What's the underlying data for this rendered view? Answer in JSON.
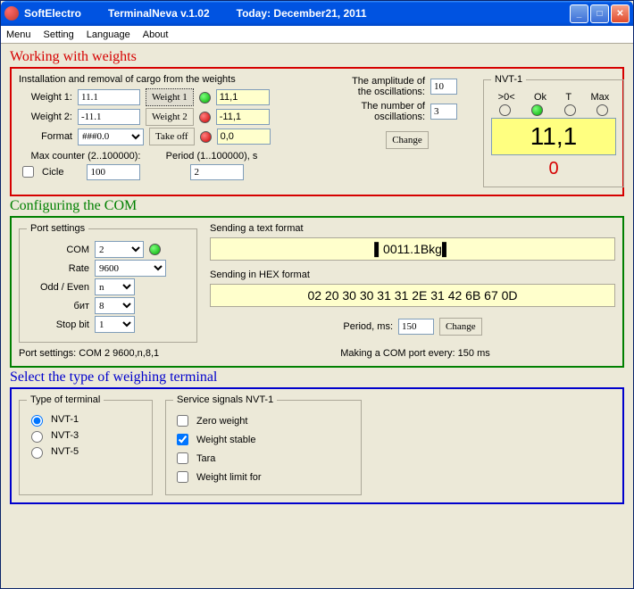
{
  "titlebar": {
    "app": "SoftElectro",
    "name": "TerminalNeva v.1.02",
    "today": "Today: December21,  2011"
  },
  "menu": [
    "Menu",
    "Setting",
    "Language",
    "About"
  ],
  "weights": {
    "title": "Working with weights",
    "install_legend": "Installation and removal of cargo from the weights",
    "w1_lbl": "Weight 1:",
    "w1": "11.1",
    "w1_btn": "Weight 1",
    "w1_out": "11,1",
    "w2_lbl": "Weight 2:",
    "w2": "-11.1",
    "w2_btn": "Weight 2",
    "w2_out": "-11,1",
    "fmt_lbl": "Format",
    "fmt": "###0.0",
    "takeoff_btn": "Take off",
    "fmt_out": "0,0",
    "maxc_lbl": "Max counter (2..100000):",
    "period_lbl": "Period (1..100000), s",
    "cicle_lbl": "Cicle",
    "maxc": "100",
    "period": "2",
    "amp_lbl": "The amplitude of the oscillations:",
    "amp": "10",
    "num_lbl": "The number of oscillations:",
    "num": "3",
    "change_btn": "Change",
    "nvt_title": "NVT-1",
    "nvt_cols": [
      ">0<",
      "Ok",
      "T",
      "Max"
    ],
    "big": "11,1",
    "zero": "0"
  },
  "com": {
    "title": "Configuring the COM",
    "legend": "Port settings",
    "com_lbl": "COM",
    "com": "2",
    "rate_lbl": "Rate",
    "rate": "9600",
    "odd_lbl": "Odd / Even",
    "odd": "n",
    "bit_lbl": "бит",
    "bit": "8",
    "stop_lbl": "Stop bit",
    "stop": "1",
    "summary": "Port settings: COM      2    9600,n,8,1",
    "txt_lbl": "Sending a text format",
    "txt": "▌0011.1Bkg▌",
    "hex_lbl": "Sending in HEX format",
    "hex": "02 20 30 30 31 31 2E 31 42 6B 67 0D",
    "pms_lbl": "Period, ms:",
    "pms": "150",
    "change_btn": "Change",
    "make_lbl": "Making a COM port every:   150     ms"
  },
  "term": {
    "title": "Select the type of weighing terminal",
    "type_legend": "Type of terminal",
    "types": [
      "NVT-1",
      "NVT-3",
      "NVT-5"
    ],
    "svc_legend": "Service signals NVT-1",
    "svc": [
      "Zero weight",
      "Weight stable",
      "Tara",
      "Weight limit for"
    ]
  }
}
